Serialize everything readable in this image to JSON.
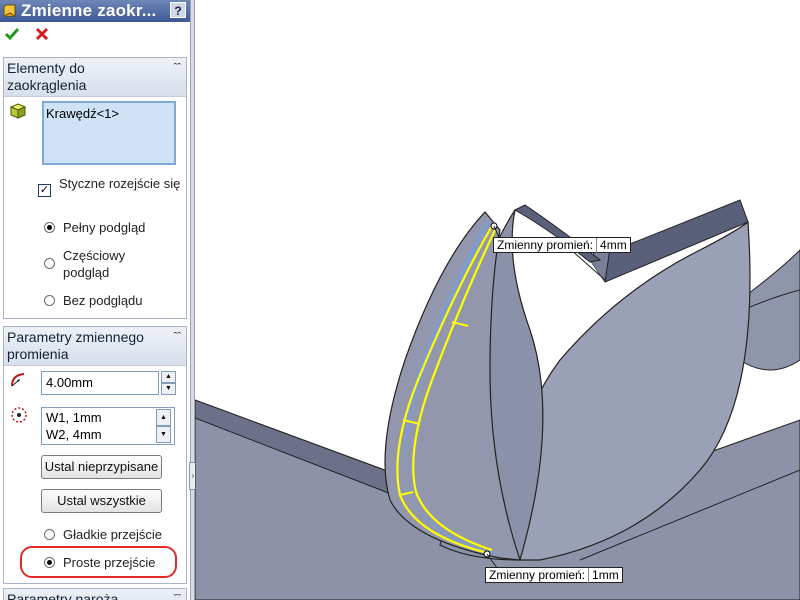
{
  "panel": {
    "title": "Zmienne zaokr...",
    "help_label": "?",
    "sections": {
      "items": {
        "title": "Elementy do zaokrąglenia",
        "selected_items": [
          "Krawędź<1>"
        ],
        "tangent_propagation_label": "Styczne rozejście się",
        "preview_options": [
          "Pełny podgląd",
          "Częściowy podgląd",
          "Bez podglądu"
        ],
        "preview_selected": "Pełny podgląd"
      },
      "variable_radius": {
        "title": "Parametry zmiennego promienia",
        "radius_value": "4.00mm",
        "vertex_list": [
          "W1, 1mm",
          "W2, 4mm"
        ],
        "set_unassigned_label": "Ustal nieprzypisane",
        "set_all_label": "Ustal wszystkie",
        "transition_options": [
          "Gładkie przejście",
          "Proste przejście"
        ],
        "transition_selected": "Proste przejście"
      },
      "setback": {
        "title": "Parametry naroża"
      }
    }
  },
  "viewport": {
    "callouts": [
      {
        "label": "Zmienny promień:",
        "value": "4mm"
      },
      {
        "label": "Zmienny promień:",
        "value": "1mm"
      }
    ]
  },
  "colors": {
    "part_face": "#9aa0b6",
    "part_dark": "#5a607a",
    "edge_highlight": "#ffff00",
    "fillet_face": "#7f9ccc",
    "annotation_ring": "#e32a2a"
  }
}
